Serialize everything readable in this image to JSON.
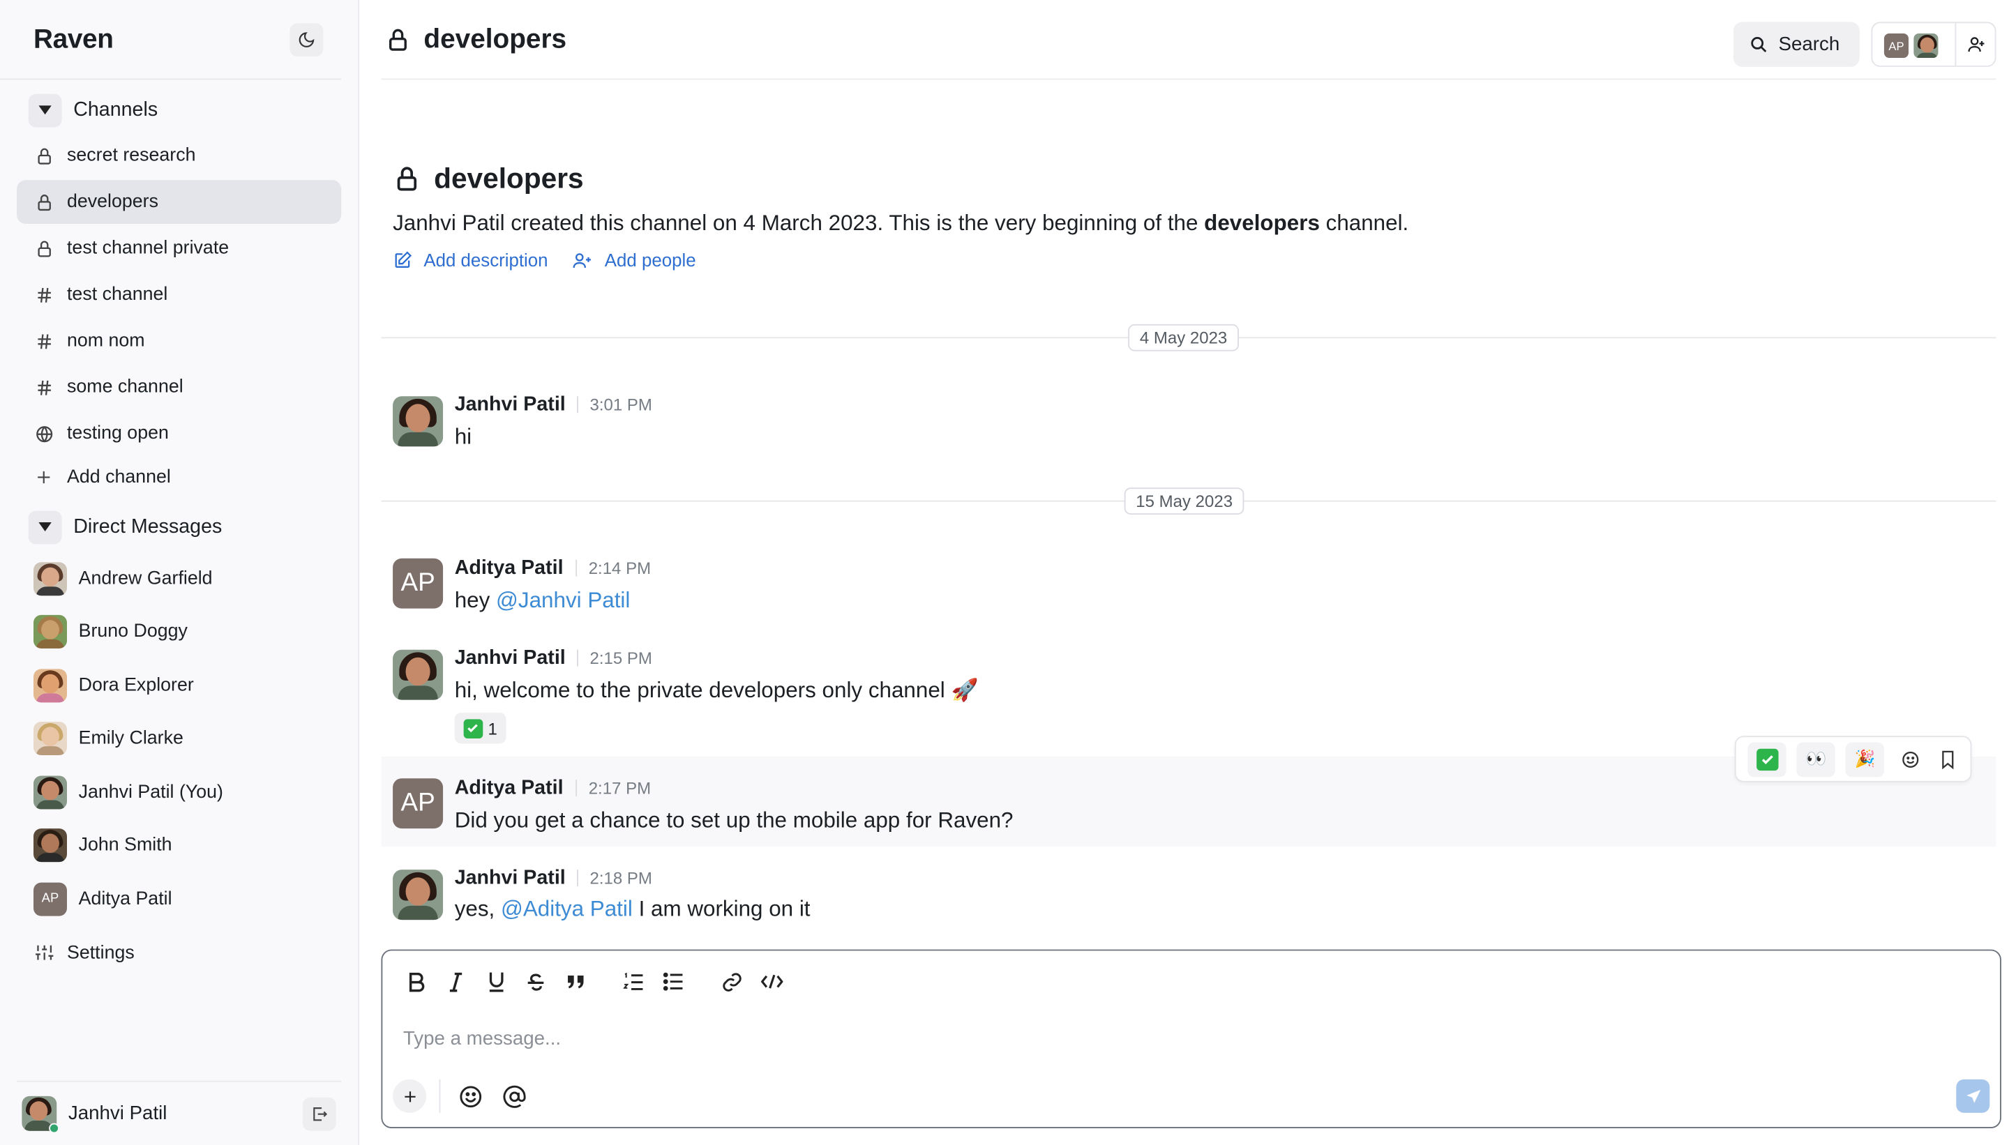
{
  "app": {
    "name": "Raven"
  },
  "sidebar": {
    "channels_heading": "Channels",
    "channels": [
      {
        "label": "secret research",
        "icon": "lock-icon"
      },
      {
        "label": "developers",
        "icon": "lock-icon",
        "active": true
      },
      {
        "label": "test channel private",
        "icon": "lock-icon"
      },
      {
        "label": "test channel",
        "icon": "hash-icon"
      },
      {
        "label": "nom nom",
        "icon": "hash-icon"
      },
      {
        "label": "some channel",
        "icon": "hash-icon"
      },
      {
        "label": "testing open",
        "icon": "globe-icon"
      }
    ],
    "add_channel": "Add channel",
    "dm_heading": "Direct Messages",
    "dms": [
      {
        "label": "Andrew Garfield"
      },
      {
        "label": "Bruno Doggy"
      },
      {
        "label": "Dora Explorer"
      },
      {
        "label": "Emily Clarke"
      },
      {
        "label": "Janhvi Patil (You)"
      },
      {
        "label": "John Smith"
      },
      {
        "label": "Aditya Patil",
        "initials": "AP"
      }
    ],
    "settings": "Settings",
    "current_user": "Janhvi Patil"
  },
  "header": {
    "channel_name": "developers",
    "search_label": "Search",
    "member_initials": "AP"
  },
  "intro": {
    "title": "developers",
    "desc_prefix": "Janhvi Patil created this channel on 4 March 2023. This is the very beginning of the ",
    "desc_channel": "developers",
    "desc_suffix": " channel.",
    "add_description": "Add description",
    "add_people": "Add people"
  },
  "dates": [
    "4 May 2023",
    "15 May 2023"
  ],
  "messages": [
    {
      "author": "Janhvi Patil",
      "time": "3:01 PM",
      "text": "hi"
    },
    {
      "author": "Aditya Patil",
      "initials": "AP",
      "time": "2:14 PM",
      "text": "hey ",
      "mention": "@Janhvi Patil"
    },
    {
      "author": "Janhvi Patil",
      "time": "2:15 PM",
      "text": "hi, welcome to the private developers only channel 🚀",
      "reaction_count": "1"
    },
    {
      "author": "Aditya Patil",
      "initials": "AP",
      "time": "2:17 PM",
      "text": "Did you get a chance to set up the mobile app for Raven?"
    },
    {
      "author": "Janhvi Patil",
      "time": "2:18 PM",
      "text_prefix": "yes, ",
      "mention": "@Aditya Patil",
      "text_suffix": " I am working on it"
    }
  ],
  "hover_toolbar": {
    "eyes": "👀",
    "party": "🎉"
  },
  "composer": {
    "placeholder": "Type a message..."
  },
  "colors": {
    "accent": "#2d6ed0",
    "mention": "#3d8bd4",
    "active_item": "#e4e5ea",
    "send_disabled": "#a7c6ec"
  }
}
